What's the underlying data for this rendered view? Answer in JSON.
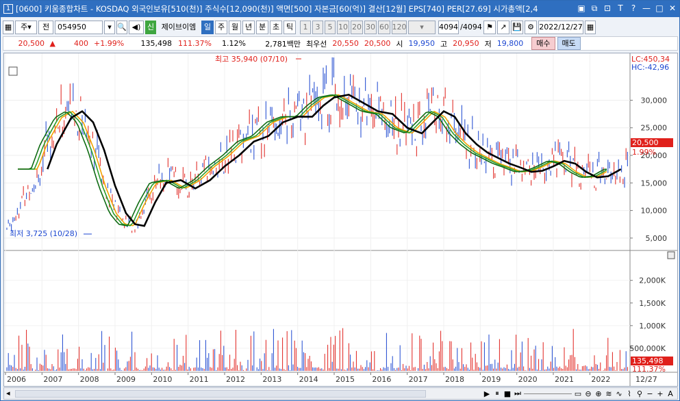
{
  "window": {
    "number": "1",
    "title": "[0600] 키움종합차트 - KOSDAQ 외국인보유[510(천)] 주식수[12,090(천)] 액면[500] 자본금[60(억)] 결산[12월] EPS[740] PER[27.69] 시가총액[2,4"
  },
  "toolbar": {
    "period_a": "주",
    "period_b": "전",
    "code": "054950",
    "credit_badge": "신",
    "stock_name": "제이브이엠",
    "intervals": [
      "일",
      "주",
      "월",
      "년",
      "분",
      "초",
      "틱"
    ],
    "selected_interval": "일",
    "numbers": [
      "1",
      "3",
      "5",
      "10",
      "20",
      "30",
      "60",
      "120"
    ],
    "count": "4094",
    "count_total": "/4094",
    "date": "2022/12/27"
  },
  "pricebar": {
    "price": "20,500",
    "change": "400",
    "change_pct": "+1.99%",
    "volume": "135,498",
    "vol_ratio": "111.37%",
    "turnover": "1.12%",
    "amount": "2,781백만",
    "pref_label": "최우선",
    "ask": "20,550",
    "bid": "20,500",
    "open_label": "시",
    "open": "19,950",
    "high_label": "고",
    "high": "20,950",
    "low_label": "저",
    "low": "19,800",
    "buy": "매수",
    "sell": "매도"
  },
  "chart_labels": {
    "max_label": "최고 35,940 (07/10)",
    "min_label": "최저 3,725 (10/28)",
    "lc": "LC:450,34",
    "hc": "HC:-42,96",
    "cur_price": "20,500",
    "cur_pct": "1.99%",
    "cur_vol": "135,498",
    "cur_vol_pct": "111.37%",
    "date_label": "12/27"
  },
  "chart_data": {
    "type": "line",
    "price_axis": [
      "30,000",
      "25,000",
      "20,000",
      "15,000",
      "10,000",
      "5,000"
    ],
    "volume_axis": [
      "2,000K",
      "1,500K",
      "1,000K",
      "500,000K"
    ],
    "x_labels": [
      "2006",
      "2007",
      "2008",
      "2009",
      "2010",
      "2011",
      "2012",
      "2013",
      "2014",
      "2015",
      "2016",
      "2017",
      "2018",
      "2019",
      "2020",
      "2021",
      "2022"
    ],
    "price_ylim": [
      3000,
      38000
    ],
    "volume_ylim": [
      0,
      2600
    ],
    "series": [
      {
        "color": "#000000",
        "x": [
          2007.15,
          2007.4,
          2007.8,
          2008.1,
          2008.4,
          2008.7,
          2009.0,
          2009.3,
          2009.55,
          2009.8,
          2010.1,
          2010.4,
          2010.8,
          2011.2,
          2011.6,
          2012.0,
          2012.4,
          2012.8,
          2013.2,
          2013.6,
          2014.0,
          2014.4,
          2014.7,
          2015.0,
          2015.4,
          2015.8,
          2016.2,
          2016.6,
          2017.0,
          2017.4,
          2017.7,
          2018.0,
          2018.3,
          2018.6,
          2018.9,
          2019.2,
          2019.5,
          2019.8,
          2020.1,
          2020.4,
          2020.7,
          2021.0,
          2021.3,
          2021.6,
          2021.9,
          2022.2,
          2022.5,
          2022.85
        ],
        "values": [
          17500,
          22000,
          26800,
          28000,
          26000,
          21000,
          14500,
          9500,
          7500,
          7200,
          11500,
          15000,
          15500,
          14000,
          15500,
          18000,
          20000,
          22500,
          23500,
          26000,
          27000,
          27000,
          29000,
          30500,
          31000,
          29500,
          28000,
          27500,
          25000,
          24000,
          26000,
          28000,
          27000,
          24000,
          22000,
          20500,
          19500,
          18500,
          17800,
          17000,
          17200,
          18000,
          19000,
          18500,
          17000,
          16000,
          16200,
          17500
        ]
      }
    ]
  }
}
